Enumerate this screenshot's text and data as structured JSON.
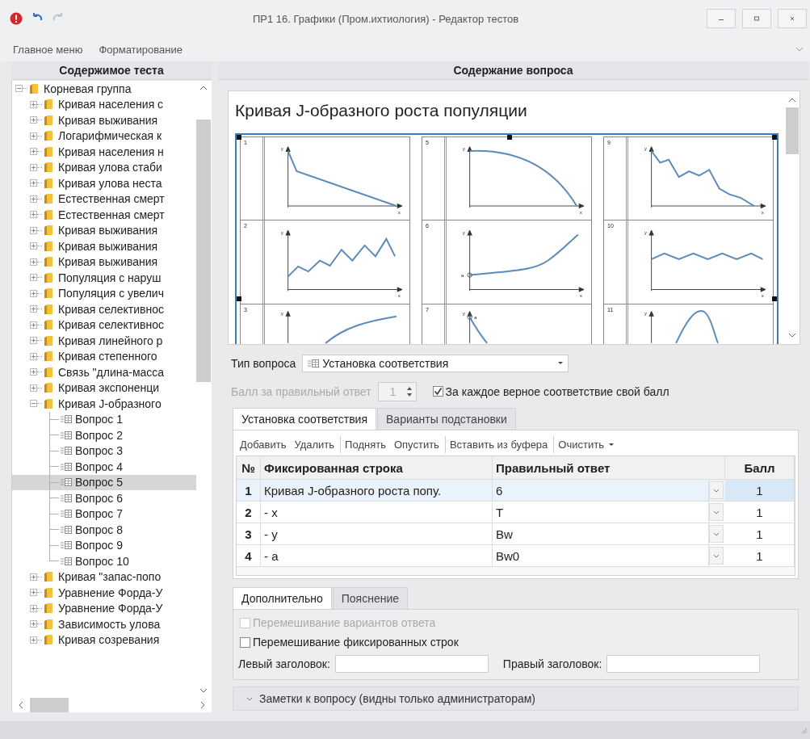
{
  "window": {
    "title": "ПР1 16. Графики (Пром.ихтиология) - Редактор тестов",
    "undo_enabled": true,
    "redo_enabled": false
  },
  "ribbon_tabs": [
    {
      "label": "Главное меню"
    },
    {
      "label": "Форматирование"
    }
  ],
  "tree": {
    "title": "Содержимое теста",
    "items": [
      {
        "kind": "folder",
        "label": "Корневая группа",
        "expanded": true,
        "selected": false,
        "children": [
          {
            "kind": "folder",
            "label": "Кривая населения с",
            "expanded": false,
            "selected": false
          },
          {
            "kind": "folder",
            "label": "Кривая выживания",
            "expanded": false,
            "selected": false
          },
          {
            "kind": "folder",
            "label": "Логарифмическая к",
            "expanded": false,
            "selected": false
          },
          {
            "kind": "folder",
            "label": "Кривая населения н",
            "expanded": false,
            "selected": false
          },
          {
            "kind": "folder",
            "label": "Кривая улова стаби",
            "expanded": false,
            "selected": false
          },
          {
            "kind": "folder",
            "label": "Кривая улова неста",
            "expanded": false,
            "selected": false
          },
          {
            "kind": "folder",
            "label": "Естественная смерт",
            "expanded": false,
            "selected": false
          },
          {
            "kind": "folder",
            "label": "Естественная смерт",
            "expanded": false,
            "selected": false
          },
          {
            "kind": "folder",
            "label": "Кривая выживания",
            "expanded": false,
            "selected": false
          },
          {
            "kind": "folder",
            "label": "Кривая выживания",
            "expanded": false,
            "selected": false
          },
          {
            "kind": "folder",
            "label": "Кривая выживания",
            "expanded": false,
            "selected": false
          },
          {
            "kind": "folder",
            "label": "Популяция с наруш",
            "expanded": false,
            "selected": false
          },
          {
            "kind": "folder",
            "label": "Популяция с увелич",
            "expanded": false,
            "selected": false
          },
          {
            "kind": "folder",
            "label": "Кривая селективнос",
            "expanded": false,
            "selected": false
          },
          {
            "kind": "folder",
            "label": "Кривая селективнос",
            "expanded": false,
            "selected": false
          },
          {
            "kind": "folder",
            "label": "Кривая линейного р",
            "expanded": false,
            "selected": false
          },
          {
            "kind": "folder",
            "label": "Кривая степенного",
            "expanded": false,
            "selected": false
          },
          {
            "kind": "folder",
            "label": "Связь \"длина-масса",
            "expanded": false,
            "selected": false
          },
          {
            "kind": "folder",
            "label": "Кривая экспоненци",
            "expanded": false,
            "selected": false
          },
          {
            "kind": "folder",
            "label": "Кривая J-образного",
            "expanded": true,
            "selected": false,
            "children": [
              {
                "kind": "question",
                "label": "Вопрос 1",
                "selected": false
              },
              {
                "kind": "question",
                "label": "Вопрос 2",
                "selected": false
              },
              {
                "kind": "question",
                "label": "Вопрос 3",
                "selected": false
              },
              {
                "kind": "question",
                "label": "Вопрос 4",
                "selected": false
              },
              {
                "kind": "question",
                "label": "Вопрос 5",
                "selected": true
              },
              {
                "kind": "question",
                "label": "Вопрос 6",
                "selected": false
              },
              {
                "kind": "question",
                "label": "Вопрос 7",
                "selected": false
              },
              {
                "kind": "question",
                "label": "Вопрос 8",
                "selected": false
              },
              {
                "kind": "question",
                "label": "Вопрос 9",
                "selected": false
              },
              {
                "kind": "question",
                "label": "Вопрос 10",
                "selected": false
              }
            ]
          },
          {
            "kind": "folder",
            "label": "Кривая \"запас-попо",
            "expanded": false,
            "selected": false
          },
          {
            "kind": "folder",
            "label": "Уравнение Форда-У",
            "expanded": false,
            "selected": false
          },
          {
            "kind": "folder",
            "label": "Уравнение Форда-У",
            "expanded": false,
            "selected": false
          },
          {
            "kind": "folder",
            "label": "Зависимость улова",
            "expanded": false,
            "selected": false
          },
          {
            "kind": "folder",
            "label": "Кривая созревания",
            "expanded": false,
            "selected": false
          }
        ]
      }
    ]
  },
  "question": {
    "title": "Содержание вопроса",
    "heading": "Кривая J-образного роста популяции",
    "panels": [
      {
        "number": "1",
        "kind": "drop",
        "y_label": "y",
        "x_label": "x"
      },
      {
        "number": "5",
        "kind": "concave",
        "y_label": "y",
        "x_label": "x"
      },
      {
        "number": "9",
        "kind": "jagged",
        "y_label": "y",
        "x_label": "x"
      },
      {
        "number": "2",
        "kind": "zigzag",
        "y_label": "y",
        "x_label": "x"
      },
      {
        "number": "6",
        "kind": "exponential",
        "y_label": "y",
        "x_label": "x",
        "point_label": "a"
      },
      {
        "number": "10",
        "kind": "wave",
        "y_label": "y",
        "x_label": "x"
      },
      {
        "number": "3",
        "kind": "logarithmic",
        "y_label": "y"
      },
      {
        "number": "7",
        "kind": "decay",
        "y_label": "y",
        "point_label": "a"
      },
      {
        "number": "11",
        "kind": "hump",
        "y_label": "y"
      }
    ],
    "type_label": "Тип вопроса",
    "type_value": "Установка соответствия",
    "score_label": "Балл за правильный ответ",
    "score_value": "1",
    "score_disabled": true,
    "per_match": {
      "label": "За каждое верное соответствие свой балл",
      "checked": true
    },
    "tabs": [
      {
        "label": "Установка соответствия",
        "selected": true
      },
      {
        "label": "Варианты подстановки",
        "selected": false
      }
    ],
    "toolbar": [
      {
        "label": "Добавить",
        "group_start": false,
        "dropdown": false
      },
      {
        "label": "Удалить",
        "group_start": false,
        "dropdown": false
      },
      {
        "label": "Поднять",
        "group_start": true,
        "dropdown": false
      },
      {
        "label": "Опустить",
        "group_start": false,
        "dropdown": false
      },
      {
        "label": "Вставить из буфера",
        "group_start": true,
        "dropdown": false
      },
      {
        "label": "Очистить",
        "group_start": true,
        "dropdown": true
      }
    ],
    "table": {
      "columns": [
        "№",
        "Фиксированная строка",
        "Правильный ответ",
        "Балл"
      ],
      "rows": [
        {
          "number": "1",
          "fixed": "Кривая J-образного роста попу.",
          "answer": "6",
          "score": "1",
          "selected": true
        },
        {
          "number": "2",
          "fixed": "- x",
          "answer": "T",
          "score": "1",
          "selected": false
        },
        {
          "number": "3",
          "fixed": "- y",
          "answer": "Bw",
          "score": "1",
          "selected": false
        },
        {
          "number": "4",
          "fixed": "- a",
          "answer": "Bw0",
          "score": "1",
          "selected": false
        }
      ]
    },
    "extra_tabs": [
      {
        "label": "Дополнительно",
        "selected": true
      },
      {
        "label": "Пояснение",
        "selected": false
      }
    ],
    "options": [
      {
        "label": "Перемешивание вариантов ответа",
        "checked": false,
        "disabled": true
      },
      {
        "label": "Перемешивание фиксированных строк",
        "checked": false,
        "disabled": false
      }
    ],
    "left_header_label": "Левый заголовок:",
    "right_header_label": "Правый заголовок:",
    "notes": {
      "label": "Заметки к вопросу (видны только администраторам)",
      "expanded": false
    }
  }
}
